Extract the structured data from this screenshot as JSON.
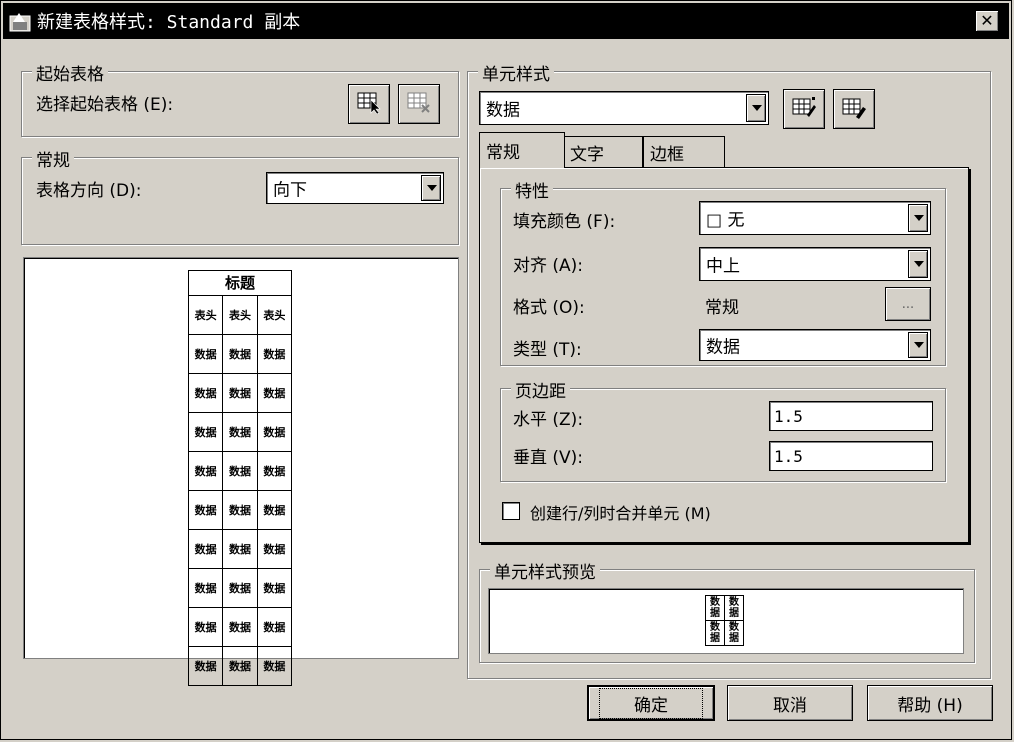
{
  "window": {
    "title": "新建表格样式: Standard 副本",
    "close_glyph": "✕"
  },
  "starting_table": {
    "group_label": "起始表格",
    "select_label": "选择起始表格 (E):",
    "select_icon": "table-select-icon",
    "remove_icon": "table-remove-icon"
  },
  "general": {
    "group_label": "常规",
    "direction_label": "表格方向 (D):",
    "direction_value": "向下"
  },
  "table_preview": {
    "title": "标题",
    "header": [
      "表头",
      "表头",
      "表头"
    ],
    "data_cell": "数据",
    "data_rows": 9
  },
  "cell_style": {
    "group_label": "单元样式",
    "selected_style": "数据",
    "new_style_icon": "create-cell-style-icon",
    "manage_style_icon": "manage-cell-styles-icon"
  },
  "tabs": [
    {
      "label": "常规",
      "active": true
    },
    {
      "label": "文字",
      "active": false
    },
    {
      "label": "边框",
      "active": false
    }
  ],
  "properties": {
    "group_label": "特性",
    "fill_color_label": "填充颜色 (F):",
    "fill_color_value": "□ 无",
    "alignment_label": "对齐 (A):",
    "alignment_value": "中上",
    "format_label": "格式 (O):",
    "format_value": "常规",
    "format_button": "...",
    "type_label": "类型 (T):",
    "type_value": "数据"
  },
  "margins": {
    "group_label": "页边距",
    "horizontal_label": "水平 (Z):",
    "horizontal_value": "1.5",
    "vertical_label": "垂直 (V):",
    "vertical_value": "1.5"
  },
  "merge_checkbox": {
    "label": "创建行/列时合并单元 (M)",
    "checked": false
  },
  "cell_style_preview": {
    "group_label": "单元样式预览",
    "cell_text": "数据"
  },
  "buttons": {
    "ok": "确定",
    "cancel": "取消",
    "help": "帮助 (H)"
  }
}
